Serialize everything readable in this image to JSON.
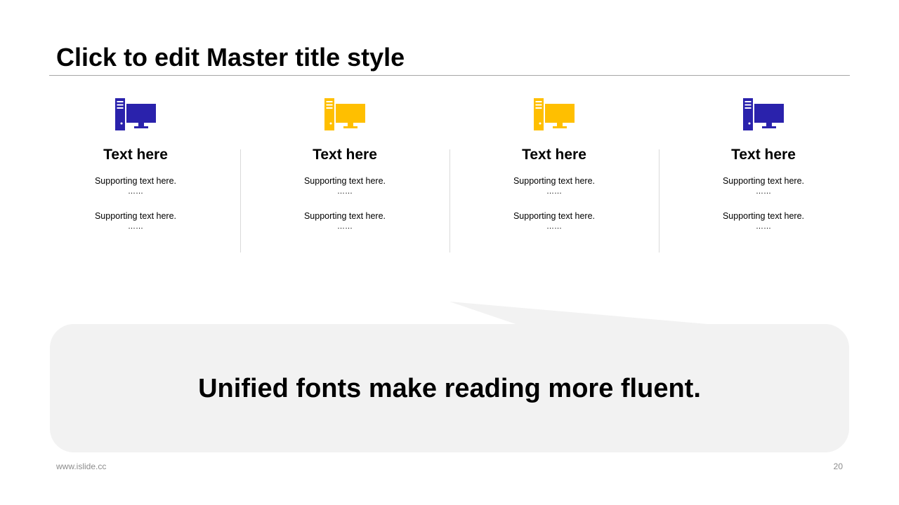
{
  "title": "Click to edit Master title style",
  "columns": [
    {
      "icon": "desktop-computer-icon",
      "icon_color": "#2a22ac",
      "heading": "Text here",
      "supporting": [
        {
          "text": "Supporting  text here.",
          "dots": "……"
        },
        {
          "text": "Supporting  text here.",
          "dots": "……"
        }
      ]
    },
    {
      "icon": "desktop-computer-icon",
      "icon_color": "#ffbf00",
      "heading": "Text here",
      "supporting": [
        {
          "text": "Supporting  text here.",
          "dots": "……"
        },
        {
          "text": "Supporting  text here.",
          "dots": "……"
        }
      ]
    },
    {
      "icon": "desktop-computer-icon",
      "icon_color": "#ffbf00",
      "heading": "Text here",
      "supporting": [
        {
          "text": "Supporting  text here.",
          "dots": "……"
        },
        {
          "text": "Supporting  text here.",
          "dots": "……"
        }
      ]
    },
    {
      "icon": "desktop-computer-icon",
      "icon_color": "#2a22ac",
      "heading": "Text here",
      "supporting": [
        {
          "text": "Supporting  text here.",
          "dots": "……"
        },
        {
          "text": "Supporting  text here.",
          "dots": "……"
        }
      ]
    }
  ],
  "callout": {
    "text": "Unified fonts make reading more fluent.",
    "background": "#f2f2f2"
  },
  "footer": {
    "site": "www.islide.cc",
    "page_number": "20"
  }
}
